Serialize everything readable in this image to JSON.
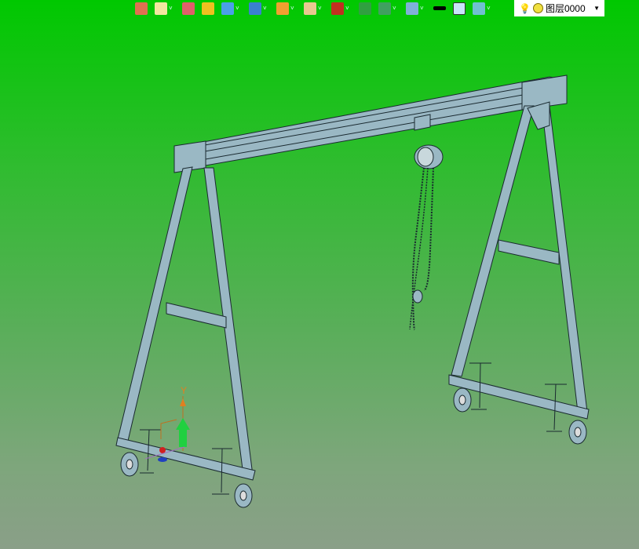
{
  "toolbar": {
    "items": [
      {
        "icon": "exit-icon",
        "color": "#e07050",
        "dropdown": false
      },
      {
        "icon": "light-icon",
        "color": "#f2e6a0",
        "dropdown": true
      },
      {
        "icon": "pencil-icon",
        "color": "#e0606a",
        "dropdown": false
      },
      {
        "icon": "box-face-icon",
        "color": "#f0c020",
        "dropdown": false
      },
      {
        "icon": "cube-icon",
        "color": "#4aa0e8",
        "dropdown": true
      },
      {
        "icon": "view-icon",
        "color": "#3a80d0",
        "dropdown": true
      },
      {
        "icon": "render-icon",
        "color": "#f0a030",
        "dropdown": true
      },
      {
        "icon": "zoom-icon",
        "color": "#e8c890",
        "dropdown": true
      },
      {
        "icon": "origin-icon",
        "color": "#c03020",
        "dropdown": true
      },
      {
        "icon": "fit-icon",
        "color": "#30a040",
        "dropdown": false
      },
      {
        "icon": "section-icon",
        "color": "#40a060",
        "dropdown": true
      },
      {
        "icon": "display-icon",
        "color": "#80b0d8",
        "dropdown": true
      },
      {
        "icon": "line-color-icon",
        "color": "#000000",
        "dropdown": false
      },
      {
        "icon": "fill-color-icon",
        "color": "#c8e4f8",
        "dropdown": false
      },
      {
        "icon": "layer-stack-icon",
        "color": "#70c0d0",
        "dropdown": true
      }
    ]
  },
  "layer": {
    "name": "图层0000"
  },
  "triad": {
    "y_label": "Y"
  },
  "colors": {
    "part": "#9ab8c4",
    "edge": "#1a2a30"
  }
}
